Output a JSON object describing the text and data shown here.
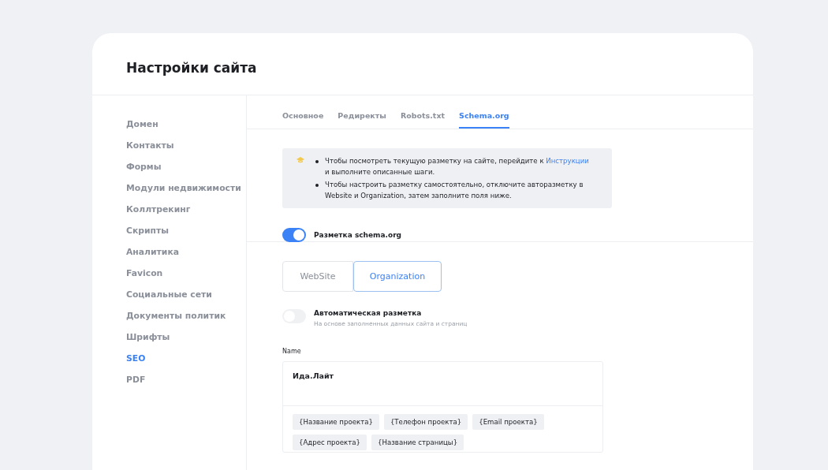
{
  "page": {
    "title": "Настройки сайта"
  },
  "sidebar": {
    "items": [
      {
        "label": "Домен",
        "selected": false
      },
      {
        "label": "Контакты",
        "selected": false
      },
      {
        "label": "Формы",
        "selected": false
      },
      {
        "label": "Модули недвижимости",
        "selected": false
      },
      {
        "label": "Коллтрекинг",
        "selected": false
      },
      {
        "label": "Скрипты",
        "selected": false
      },
      {
        "label": "Аналитика",
        "selected": false
      },
      {
        "label": "Favicon",
        "selected": false
      },
      {
        "label": "Социальные сети",
        "selected": false
      },
      {
        "label": "Документы политик",
        "selected": false
      },
      {
        "label": "Шрифты",
        "selected": false
      },
      {
        "label": "SEO",
        "selected": true
      },
      {
        "label": "PDF",
        "selected": false
      }
    ]
  },
  "tabs": [
    {
      "label": "Основное",
      "selected": false
    },
    {
      "label": "Редиректы",
      "selected": false
    },
    {
      "label": "Robots.txt",
      "selected": false
    },
    {
      "label": "Schema.org",
      "selected": true
    }
  ],
  "info": {
    "bullets": [
      {
        "text": "Чтобы посмотреть текущую разметку на сайте, перейдите к",
        "link": "Инструкции",
        "rest": "и выполните описанные шаги."
      },
      {
        "text": "Чтобы настроить разметку самостоятельно, отключите авторазметку в Website и Organization, затем заполните поля ниже."
      }
    ]
  },
  "schema_toggle": {
    "label": "Разметка schema.org",
    "on": true
  },
  "segments": [
    {
      "label": "WebSite",
      "selected": false
    },
    {
      "label": "Organization",
      "selected": true
    }
  ],
  "auto_toggle": {
    "label": "Автоматическая разметка",
    "hint": "На основе заполненных данных сайта и страниц",
    "on": false
  },
  "name_field": {
    "label": "Name",
    "value": "Ида.Лайт",
    "chips": [
      "{Название проекта}",
      "{Телефон проекта}",
      "{Email проекта}",
      "{Адрес проекта}",
      "{Название страницы}"
    ]
  }
}
